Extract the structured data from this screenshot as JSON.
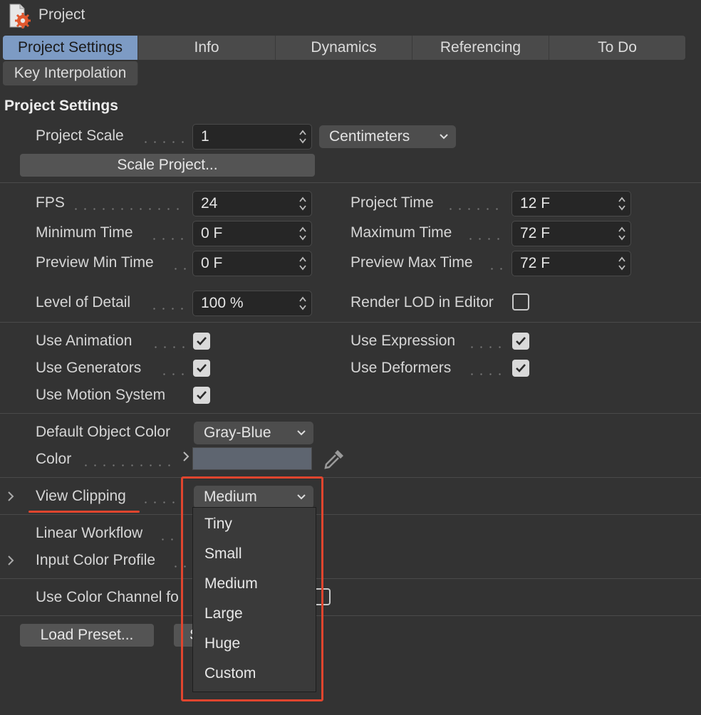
{
  "window": {
    "title": "Project"
  },
  "tabs": [
    "Project Settings",
    "Info",
    "Dynamics",
    "Referencing",
    "To Do",
    "Key Interpolation"
  ],
  "section_title": "Project Settings",
  "project_scale": {
    "label": "Project Scale",
    "value": "1",
    "unit": "Centimeters"
  },
  "scale_project_button": "Scale Project...",
  "time": {
    "fps_label": "FPS",
    "fps": "24",
    "project_time_label": "Project Time",
    "project_time": "12 F",
    "min_time_label": "Minimum Time",
    "min_time": "0 F",
    "max_time_label": "Maximum Time",
    "max_time": "72 F",
    "preview_min_label": "Preview Min Time",
    "preview_min": "0 F",
    "preview_max_label": "Preview Max Time",
    "preview_max": "72 F"
  },
  "lod": {
    "label": "Level of Detail",
    "value": "100 %",
    "render_label": "Render LOD in Editor",
    "render_checked": false
  },
  "flags": {
    "use_animation": "Use Animation",
    "use_expression": "Use Expression",
    "use_generators": "Use Generators",
    "use_deformers": "Use Deformers",
    "use_motion_system": "Use Motion System"
  },
  "object_color": {
    "label": "Default Object Color",
    "value": "Gray-Blue",
    "color_label": "Color",
    "swatch": "#5e6570"
  },
  "view_clipping": {
    "label": "View Clipping",
    "value": "Medium"
  },
  "linear_workflow": "Linear Workflow",
  "input_color_profile": "Input Color Profile",
  "use_color_channel": "Use Color Channel fo",
  "load_preset": "Load Preset...",
  "save_preset_partial": "S",
  "dropdown_menu": {
    "options": [
      "Tiny",
      "Small",
      "Medium",
      "Large",
      "Huge",
      "Custom"
    ]
  },
  "colors": {
    "background": "#333333",
    "active_tab": "#7d9bc4",
    "highlight": "#e0452e"
  }
}
